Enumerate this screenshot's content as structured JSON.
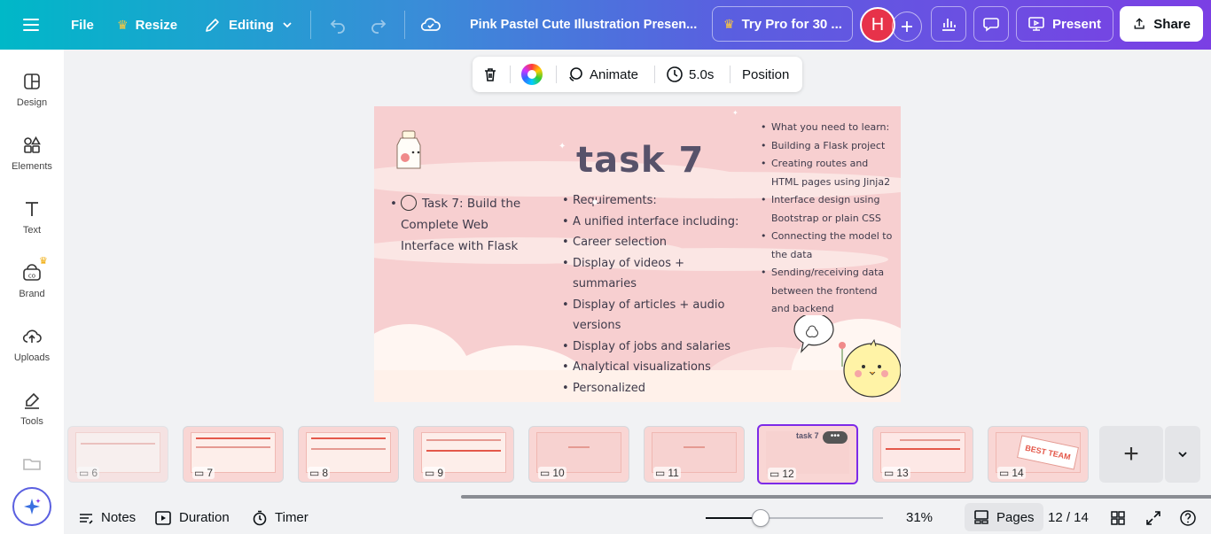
{
  "topbar": {
    "file": "File",
    "resize": "Resize",
    "editing": "Editing",
    "doc_title": "Pink Pastel Cute Illustration Presen...",
    "try_pro": "Try Pro for 30 ...",
    "avatar_initial": "H",
    "present": "Present",
    "share": "Share"
  },
  "rail": {
    "items": [
      {
        "label": "Design",
        "icon": "design-icon"
      },
      {
        "label": "Elements",
        "icon": "elements-icon"
      },
      {
        "label": "Text",
        "icon": "text-icon"
      },
      {
        "label": "Brand",
        "icon": "brand-icon"
      },
      {
        "label": "Uploads",
        "icon": "uploads-icon"
      },
      {
        "label": "Tools",
        "icon": "tools-icon"
      }
    ]
  },
  "context_toolbar": {
    "animate": "Animate",
    "duration": "5.0s",
    "position": "Position"
  },
  "slide": {
    "title": "task 7",
    "left_text": "Task 7: Build the Complete Web Interface with Flask",
    "middle_list": [
      "Requirements:",
      "A unified interface including:",
      "Career selection",
      "Display of videos + summaries",
      "Display of articles + audio versions",
      "Display of jobs and salaries",
      "Analytical visualizations",
      "Personalized recommendations."
    ],
    "right_list": [
      "What you need to learn:",
      "Building a Flask project",
      "Creating routes and HTML pages using Jinja2",
      "Interface design using Bootstrap or plain CSS",
      "Connecting the model to the data",
      "Sending/receiving data between the frontend and backend"
    ]
  },
  "pages": {
    "thumbnails": [
      {
        "num": "6"
      },
      {
        "num": "7"
      },
      {
        "num": "8"
      },
      {
        "num": "9"
      },
      {
        "num": "10"
      },
      {
        "num": "11"
      },
      {
        "num": "12",
        "selected": true,
        "label": "task 7"
      },
      {
        "num": "13"
      },
      {
        "num": "14",
        "label": "BEST TEAM"
      }
    ],
    "add": "+"
  },
  "bottombar": {
    "notes": "Notes",
    "duration": "Duration",
    "timer": "Timer",
    "zoom": "31%",
    "zoom_fraction": 0.31,
    "pages": "Pages",
    "page_count": "12 / 14"
  },
  "colors": {
    "brand_purple": "#7d2ae8",
    "slide_pink": "#f7cfd0",
    "avatar_red": "#e7324a"
  }
}
